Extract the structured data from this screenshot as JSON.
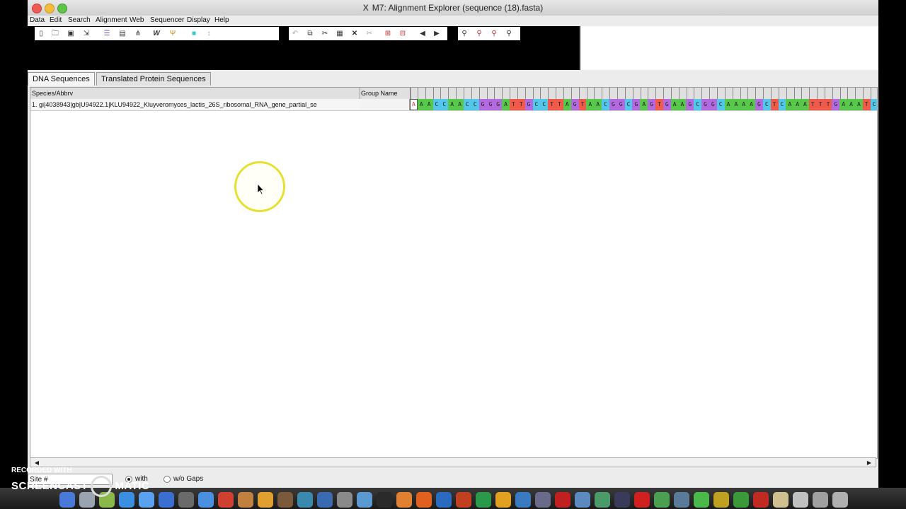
{
  "window": {
    "title": "M7: Alignment Explorer (sequence (18).fasta)"
  },
  "menu": [
    "Data",
    "Edit",
    "Search",
    "Alignment",
    "Web",
    "Sequencer",
    "Display",
    "Help"
  ],
  "tabs": [
    {
      "label": "DNA Sequences",
      "active": true
    },
    {
      "label": "Translated Protein Sequences",
      "active": false
    }
  ],
  "table": {
    "headers": {
      "species": "Species/Abbrv",
      "group": "Group Name"
    },
    "rows": [
      {
        "species": "1. gi|4038943|gb|U94922.1|KLU94922_Kluyveromyces_lactis_26S_ribosomal_RNA_gene_partial_se",
        "group": ""
      }
    ],
    "sequence": "AAACCAACCGGGATTGCCTTAGTAACGGCGAGTGAAGCGGCAAAAGCTCAAATTTGAAATC"
  },
  "base_colors": {
    "A": "#57c84a",
    "C": "#52c7ea",
    "G": "#b36ae0",
    "T": "#ef5a4a"
  },
  "status": {
    "site_label": "Site #",
    "gap_options": [
      "with",
      "w/o Gaps"
    ],
    "selected_gap_option": "with"
  },
  "watermark": {
    "line1": "RECORDED WITH",
    "line2_left": "SCREENCAST",
    "line2_right": "MATIC"
  }
}
